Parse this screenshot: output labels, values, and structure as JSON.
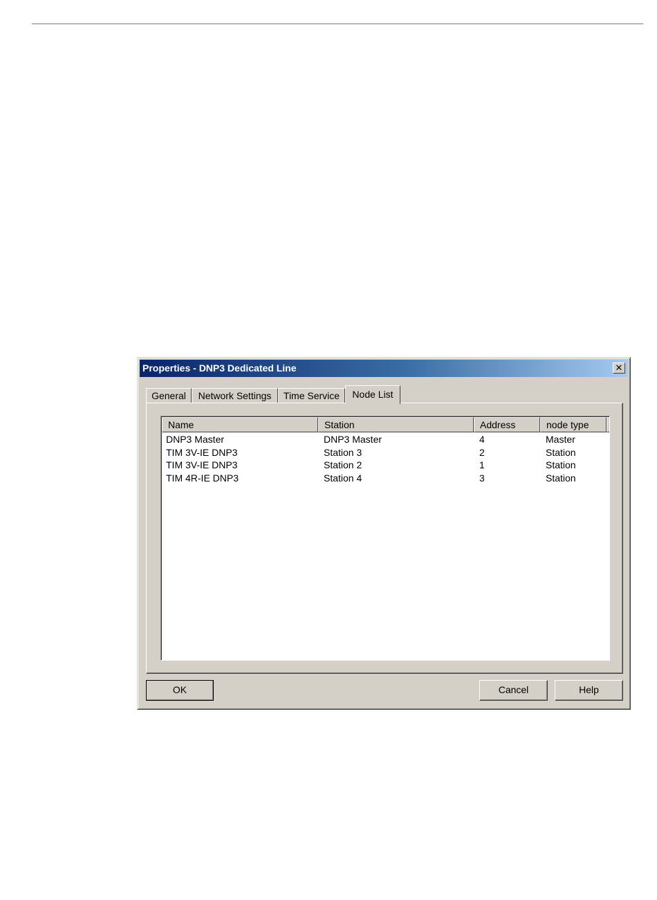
{
  "dialog": {
    "title": "Properties - DNP3 Dedicated Line",
    "close_glyph": "✕"
  },
  "tabs": [
    {
      "label": "General",
      "active": false
    },
    {
      "label": "Network Settings",
      "active": false
    },
    {
      "label": "Time Service",
      "active": false
    },
    {
      "label": "Node List",
      "active": true
    }
  ],
  "node_list": {
    "columns": [
      "Name",
      "Station",
      "Address",
      "node type"
    ],
    "rows": [
      {
        "name": "DNP3 Master",
        "station": "DNP3 Master",
        "address": "4",
        "node_type": "Master"
      },
      {
        "name": "TIM 3V-IE DNP3",
        "station": "Station 3",
        "address": "2",
        "node_type": "Station"
      },
      {
        "name": "TIM 3V-IE DNP3",
        "station": "Station 2",
        "address": "1",
        "node_type": "Station"
      },
      {
        "name": "TIM 4R-IE DNP3",
        "station": "Station 4",
        "address": "3",
        "node_type": "Station"
      }
    ]
  },
  "buttons": {
    "ok": "OK",
    "cancel": "Cancel",
    "help": "Help"
  }
}
